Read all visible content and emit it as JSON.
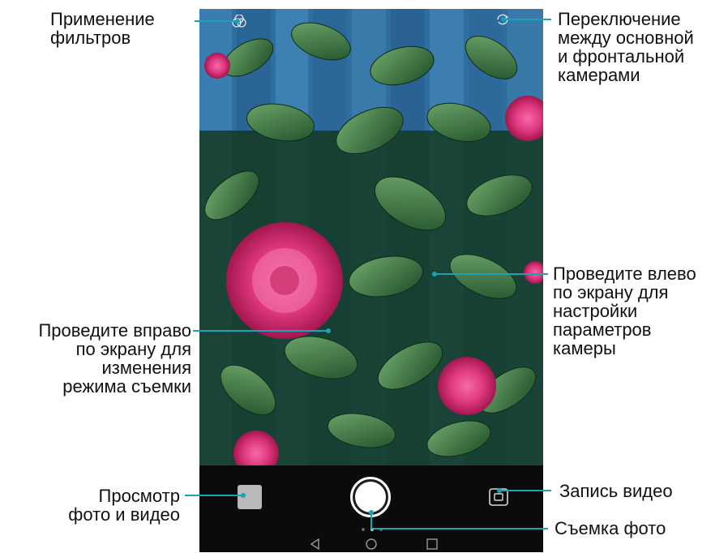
{
  "callouts": {
    "filters": "Применение\nфильтров",
    "switch_camera": "Переключение\nмежду основной\nи фронтальной\nкамерами",
    "swipe_left": "Проведите влево\nпо экрану для\nнастройки\nпараметров\nкамеры",
    "swipe_right": "Проведите вправо\nпо экрану для\nизменения\nрежима съемки",
    "gallery": "Просмотр\nфото и видео",
    "record_video": "Запись видео",
    "take_photo": "Съемка фото"
  },
  "icons": {
    "filter": "filter-icon",
    "switch": "switch-camera-icon",
    "gallery": "gallery-thumbnail",
    "shutter": "shutter-button",
    "video": "video-record-icon",
    "nav_back": "back-triangle-icon",
    "nav_home": "home-circle-icon",
    "nav_recents": "recents-square-icon"
  },
  "colors": {
    "callout_line": "#1aa3b8",
    "controls_bg": "#0b0b0b"
  }
}
